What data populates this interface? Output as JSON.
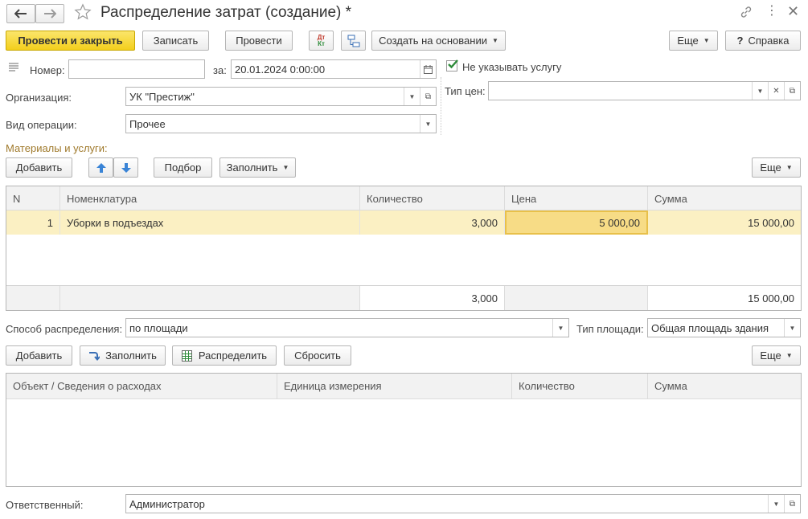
{
  "window": {
    "title": "Распределение затрат (создание) *"
  },
  "toolbar": {
    "post_close_label": "Провести и закрыть",
    "save_label": "Записать",
    "post_label": "Провести",
    "dt_kt_label": "Дт Кт",
    "create_based_label": "Создать на основании",
    "more_label": "Еще",
    "help_label": "Справка",
    "help_symbol": "?"
  },
  "header": {
    "number_label": "Номер:",
    "number_value": "",
    "date_label": "за:",
    "date_value": "20.01.2024  0:00:00",
    "no_service_label": "Не указывать услугу",
    "no_service_checked": true,
    "org_label": "Организация:",
    "org_value": "УК \"Престиж\"",
    "operation_label": "Вид операции:",
    "operation_value": "Прочее",
    "price_type_label": "Тип цен:",
    "price_type_value": ""
  },
  "materials": {
    "section_title": "Материалы и услуги:",
    "add_label": "Добавить",
    "pick_label": "Подбор",
    "fill_label": "Заполнить",
    "more_label": "Еще",
    "columns": [
      "N",
      "Номенклатура",
      "Количество",
      "Цена",
      "Сумма"
    ],
    "rows": [
      {
        "n": "1",
        "name": "Уборки в подъездах",
        "qty": "3,000",
        "price": "5 000,00",
        "sum": "15 000,00"
      }
    ],
    "totals": {
      "qty": "3,000",
      "sum": "15 000,00"
    }
  },
  "distribution": {
    "method_label": "Способ распределения:",
    "method_value": "по площади",
    "area_type_label": "Тип площади:",
    "area_type_value": "Общая площадь здания",
    "add_label": "Добавить",
    "fill_label": "Заполнить",
    "distribute_label": "Распределить",
    "reset_label": "Сбросить",
    "more_label": "Еще",
    "columns": [
      "Объект / Сведения о расходах",
      "Единица измерения",
      "Количество",
      "Сумма"
    ]
  },
  "footer": {
    "responsible_label": "Ответственный:",
    "responsible_value": "Администратор"
  },
  "colors": {
    "primary_button": "#f3cf1c",
    "selected_row": "#fbf0c3",
    "selected_cell": "#f7dc86",
    "section_title": "#a07a2c",
    "checkbox_check": "#2e8b3a"
  }
}
